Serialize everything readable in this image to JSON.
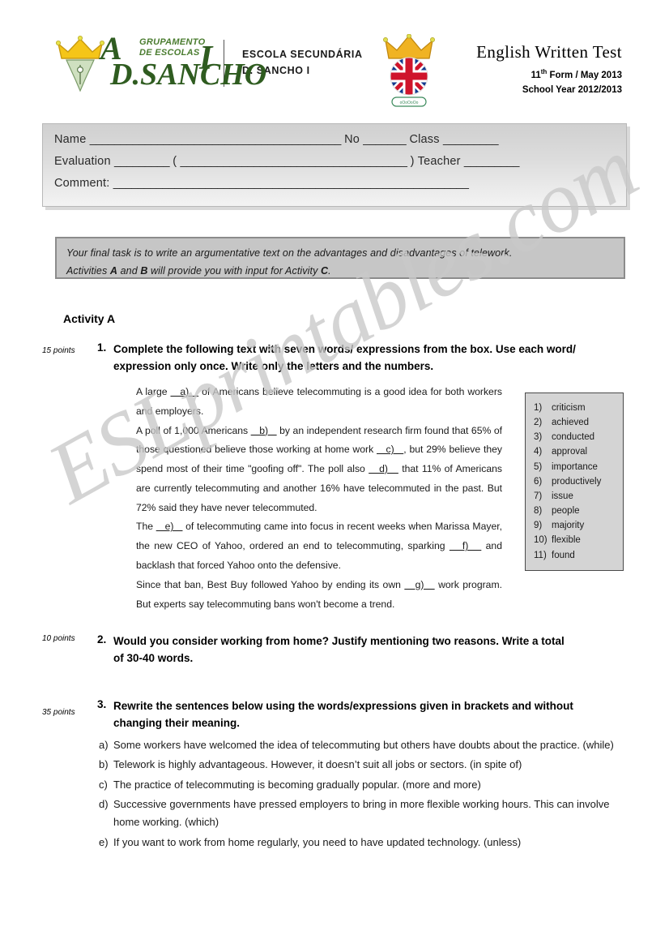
{
  "header": {
    "logo": {
      "icon": "crown-pen-nib-logo",
      "agrupamento_line1": "GRUPAMENTO",
      "agrupamento_line2": "DE ESCOLAS",
      "letter_a": "A",
      "letter_d": "D.SANCHO",
      "letter_i": "I"
    },
    "school_name_line1": "ESCOLA SECUNDÁRIA",
    "school_name_line2": "D. SANCHO I",
    "flag_logo": {
      "icon": "crown-union-jack-logo",
      "caption": "Seccao D.S."
    },
    "title": "English Written Test",
    "form_line": "11",
    "form_sup": "th",
    "form_rest": " Form / May 2013",
    "school_year": "School Year 2012/2013"
  },
  "info_box": {
    "name_label": "Name",
    "name_rule": "_________________________________________",
    "no_label": "No",
    "no_rule": "_______",
    "class_label": "Class",
    "class_rule": "_________",
    "evaluation_label": "Evaluation",
    "evaluation_rule": "_________",
    "paren_open": "(",
    "evaluation_long_rule": "_____________________________________",
    "paren_close": ")",
    "teacher_label": "Teacher",
    "teacher_rule": "_________",
    "comment_label": "Comment:",
    "comment_rule": "__________________________________________________________"
  },
  "task_box": {
    "line1": "Your final task is to write an argumentative text on the advantages and disadvantages of telework.",
    "line2_pre": "Activities ",
    "line2_a": "A",
    "line2_mid": " and ",
    "line2_b": "B",
    "line2_post": " will provide you with input for Activity ",
    "line2_c": "C",
    "line2_end": "."
  },
  "activity": {
    "title": "Activity A"
  },
  "questions": [
    {
      "points": "15 points",
      "number": "1.",
      "text": "Complete the following text with seven words/ expressions from the box. Use each word/ expression only once. Write only the letters and the numbers."
    },
    {
      "points": "10 points",
      "number": "2.",
      "text": "Would you consider working from home? Justify mentioning two reasons. Write a total of 30-40 words."
    },
    {
      "points": "35 points",
      "number": "3.",
      "text": "Rewrite the sentences below using the words/expressions given in brackets and without changing their meaning."
    }
  ],
  "passage": {
    "p1_a": "A large ",
    "p1_blank": "   a)   ",
    "p1_b": " of Americans believe telecommuting is a good idea for both workers and employers.",
    "p2_a": "A poll of 1,000 Americans ",
    "p2_blank_b": "   b)   ",
    "p2_b": " by an independent research firm found that 65% of those questioned believe those working at home work ",
    "p2_blank_c": "   c)   ",
    "p2_c": ", but 29% believe they spend most of their time \"goofing off\". The poll also ",
    "p2_blank_d": "   d)   ",
    "p2_d": " that 11% of Americans are currently telecommuting and another 16% have telecommuted in the past. But 72% said they have never telecommuted.",
    "p3_a": "The ",
    "p3_blank_e": "   e)   ",
    "p3_b": " of telecommuting came into focus in recent weeks when Marissa Mayer, the new CEO of Yahoo, ordered an end to telecommuting, sparking ",
    "p3_blank_f": "   f)   ",
    "p3_c": " and backlash that forced Yahoo onto the defensive.",
    "p4_a": "Since that ban, Best Buy followed Yahoo by ending its own ",
    "p4_blank_g": "   g)   ",
    "p4_b": " work program. But experts say telecommuting bans won't become a trend."
  },
  "word_box": [
    {
      "num": "1)",
      "word": "criticism"
    },
    {
      "num": "2)",
      "word": "achieved"
    },
    {
      "num": "3)",
      "word": "conducted"
    },
    {
      "num": "4)",
      "word": "approval"
    },
    {
      "num": "5)",
      "word": "importance"
    },
    {
      "num": "6)",
      "word": "productively"
    },
    {
      "num": "7)",
      "word": "issue"
    },
    {
      "num": "8)",
      "word": "people"
    },
    {
      "num": "9)",
      "word": "majority"
    },
    {
      "num": "10)",
      "word": "flexible"
    },
    {
      "num": "11)",
      "word": "found"
    }
  ],
  "rewrite_items": [
    {
      "letter": "a)",
      "text": "Some workers have welcomed the idea of telecommuting but others have doubts about the practice.  (while)"
    },
    {
      "letter": "b)",
      "text": "Telework is highly advantageous. However, it doesn’t suit all jobs or sectors.  (in spite of)"
    },
    {
      "letter": "c)",
      "text": "The practice of telecommuting is becoming gradually popular.  (more and more)"
    },
    {
      "letter": "d)",
      "text": "Successive governments have pressed employers to bring in more flexible working hours. This can involve home working.  (which)"
    },
    {
      "letter": "e)",
      "text": "If you want to work from home regularly, you need to have updated technology. (unless)"
    }
  ],
  "watermark": {
    "text": "ESLprintables.com"
  }
}
